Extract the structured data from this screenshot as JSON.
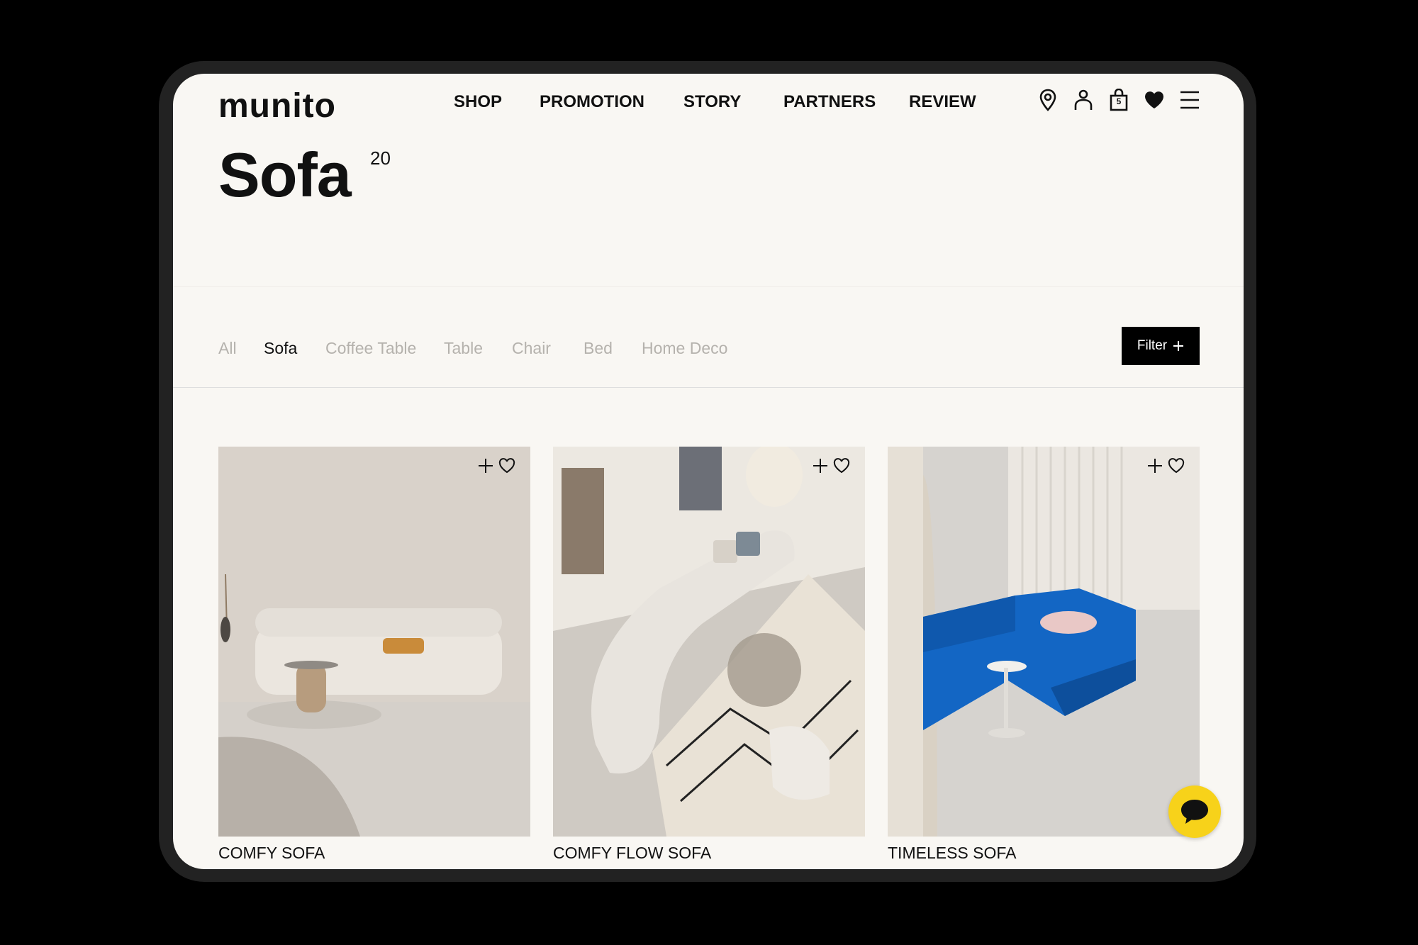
{
  "brand": {
    "logo": "munito"
  },
  "nav": {
    "items": [
      "SHOP",
      "PROMOTION",
      "STORY",
      "PARTNERS",
      "REVIEW"
    ]
  },
  "header_icons": [
    "location-pin-icon",
    "account-icon",
    "cart-icon",
    "wishlist-heart-icon",
    "menu-icon"
  ],
  "cart": {
    "count": "5"
  },
  "page": {
    "title": "Sofa",
    "count": "20"
  },
  "categories": {
    "items": [
      "All",
      "Sofa",
      "Coffee Table",
      "Table",
      "Chair",
      "Bed",
      "Home Deco"
    ],
    "active": "Sofa"
  },
  "filter": {
    "label": "Filter",
    "icon": "plus-icon"
  },
  "products": [
    {
      "name": "COMFY SOFA",
      "color": "#e7e2dc"
    },
    {
      "name": "COMFY FLOW SOFA",
      "color": "#e9e6e0"
    },
    {
      "name": "TIMELESS SOFA",
      "color": "#1366c4"
    }
  ],
  "chat": {
    "icon": "chat-bubble-icon",
    "color": "#f7d21a"
  }
}
